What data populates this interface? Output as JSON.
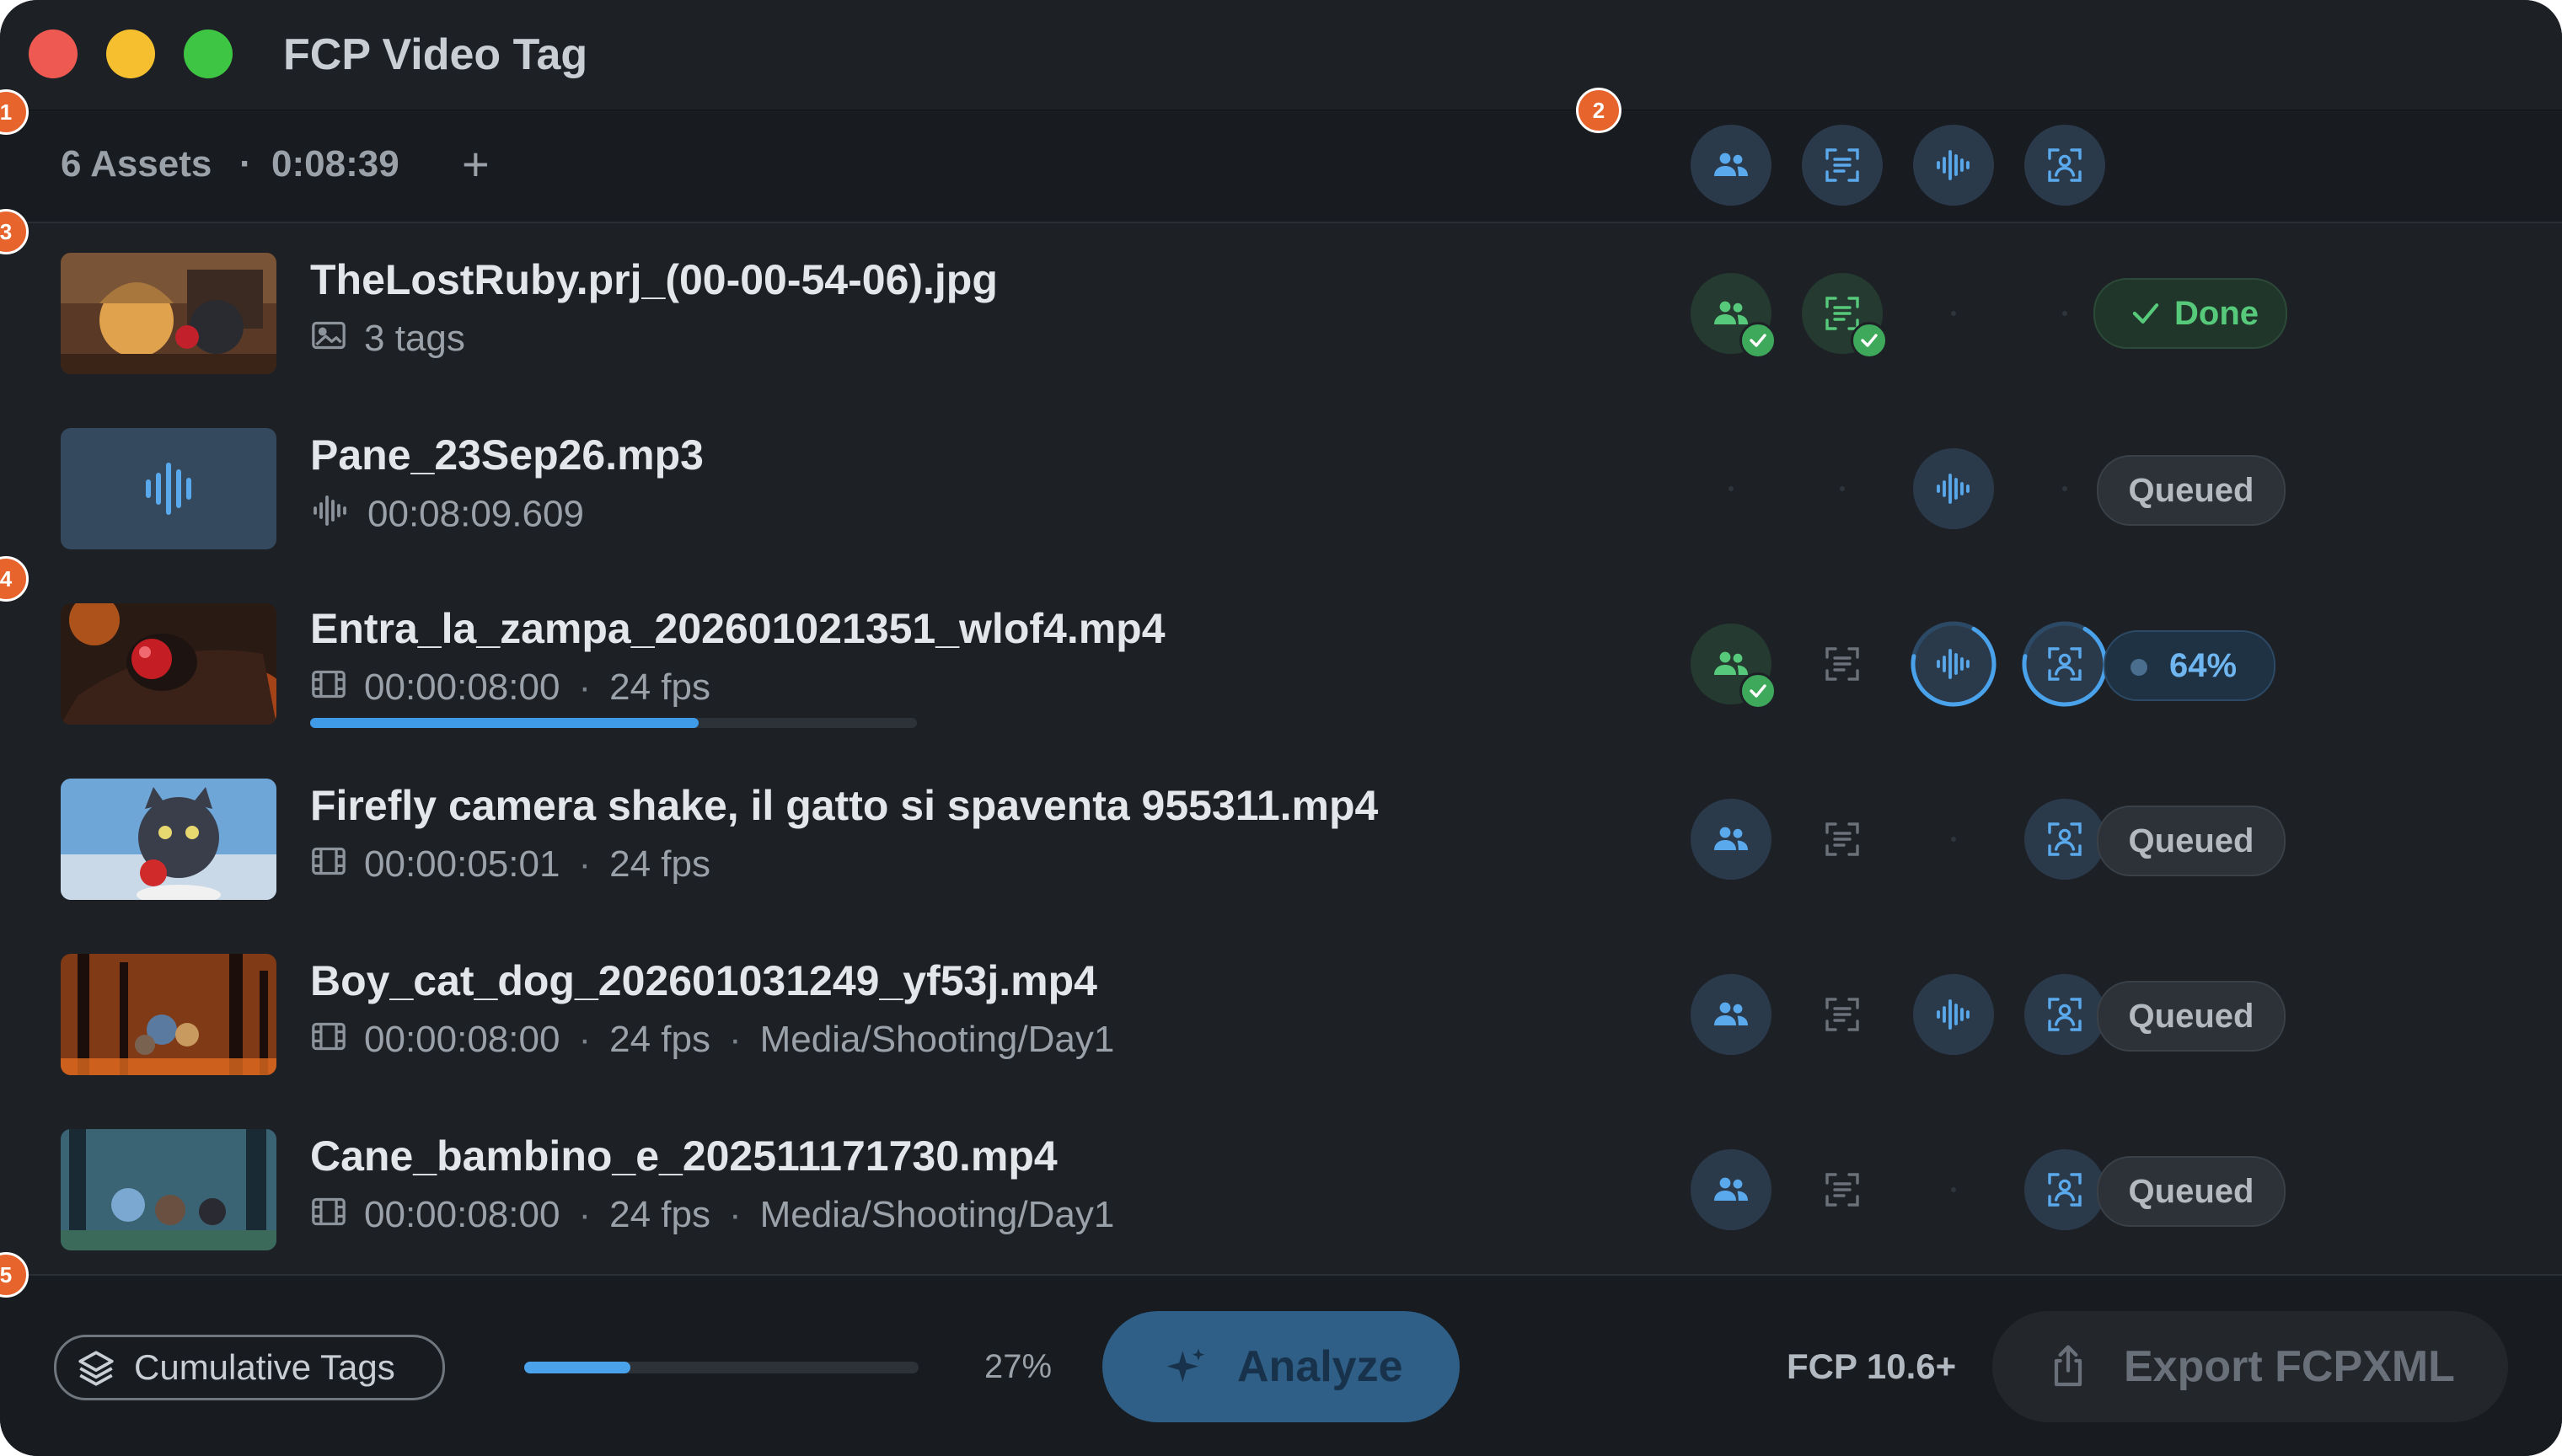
{
  "window": {
    "title": "FCP Video Tag"
  },
  "toolbar": {
    "asset_count": "6 Assets",
    "separator": "·",
    "total_duration": "0:08:39",
    "add_label": "+"
  },
  "markers": [
    "1",
    "2",
    "3",
    "4",
    "5"
  ],
  "colors": {
    "accent": "#3f9be8",
    "done": "#57c97a",
    "queued": "#b3b9c0",
    "close": "#ee5a52",
    "minimize": "#f5bf2f",
    "zoom": "#3ec544"
  },
  "header_icons": [
    "faces-icon",
    "text-scan-icon",
    "audio-waveform-icon",
    "person-focus-icon"
  ],
  "assets": [
    {
      "name": "TheLostRuby.prj_(00-00-54-06).jpg",
      "meta_icon": "image-icon",
      "meta": [
        "3 tags"
      ],
      "status": "Done",
      "progress": null,
      "analysis": [
        {
          "type": "faces-icon",
          "state": "done"
        },
        {
          "type": "text-scan-icon",
          "state": "done"
        },
        {
          "type": "audio-waveform-icon",
          "state": "none"
        },
        {
          "type": "person-focus-icon",
          "state": "none"
        }
      ]
    },
    {
      "name": "Pane_23Sep26.mp3",
      "meta_icon": "audio-waveform-icon",
      "meta": [
        "00:08:09.609"
      ],
      "status": "Queued",
      "progress": null,
      "analysis": [
        {
          "type": "faces-icon",
          "state": "none"
        },
        {
          "type": "text-scan-icon",
          "state": "none"
        },
        {
          "type": "audio-waveform-icon",
          "state": "queued"
        },
        {
          "type": "person-focus-icon",
          "state": "none"
        }
      ]
    },
    {
      "name": "Entra_la_zampa_202601021351_wlof4.mp4",
      "meta_icon": "film-icon",
      "meta": [
        "00:00:08:00",
        "24 fps"
      ],
      "status": "64%",
      "progress": 0.64,
      "analysis": [
        {
          "type": "faces-icon",
          "state": "done"
        },
        {
          "type": "text-scan-icon",
          "state": "inactive"
        },
        {
          "type": "audio-waveform-icon",
          "state": "running"
        },
        {
          "type": "person-focus-icon",
          "state": "running"
        }
      ]
    },
    {
      "name": "Firefly camera shake, il gatto si spaventa 955311.mp4",
      "meta_icon": "film-icon",
      "meta": [
        "00:00:05:01",
        "24 fps"
      ],
      "status": "Queued",
      "progress": null,
      "analysis": [
        {
          "type": "faces-icon",
          "state": "queued"
        },
        {
          "type": "text-scan-icon",
          "state": "inactive"
        },
        {
          "type": "audio-waveform-icon",
          "state": "none"
        },
        {
          "type": "person-focus-icon",
          "state": "queued"
        }
      ]
    },
    {
      "name": "Boy_cat_dog_202601031249_yf53j.mp4",
      "meta_icon": "film-icon",
      "meta": [
        "00:00:08:00",
        "24 fps",
        "Media/Shooting/Day1"
      ],
      "status": "Queued",
      "progress": null,
      "analysis": [
        {
          "type": "faces-icon",
          "state": "queued"
        },
        {
          "type": "text-scan-icon",
          "state": "inactive"
        },
        {
          "type": "audio-waveform-icon",
          "state": "queued"
        },
        {
          "type": "person-focus-icon",
          "state": "queued"
        }
      ]
    },
    {
      "name": "Cane_bambino_e_202511171730.mp4",
      "meta_icon": "film-icon",
      "meta": [
        "00:00:08:00",
        "24 fps",
        "Media/Shooting/Day1"
      ],
      "status": "Queued",
      "progress": null,
      "analysis": [
        {
          "type": "faces-icon",
          "state": "queued"
        },
        {
          "type": "text-scan-icon",
          "state": "inactive"
        },
        {
          "type": "audio-waveform-icon",
          "state": "none"
        },
        {
          "type": "person-focus-icon",
          "state": "queued"
        }
      ]
    }
  ],
  "footer": {
    "cumulative_label": "Cumulative Tags",
    "progress": 0.27,
    "progress_label": "27%",
    "analyze_label": "Analyze",
    "fcp_version": "FCP 10.6+",
    "export_label": "Export FCPXML"
  }
}
